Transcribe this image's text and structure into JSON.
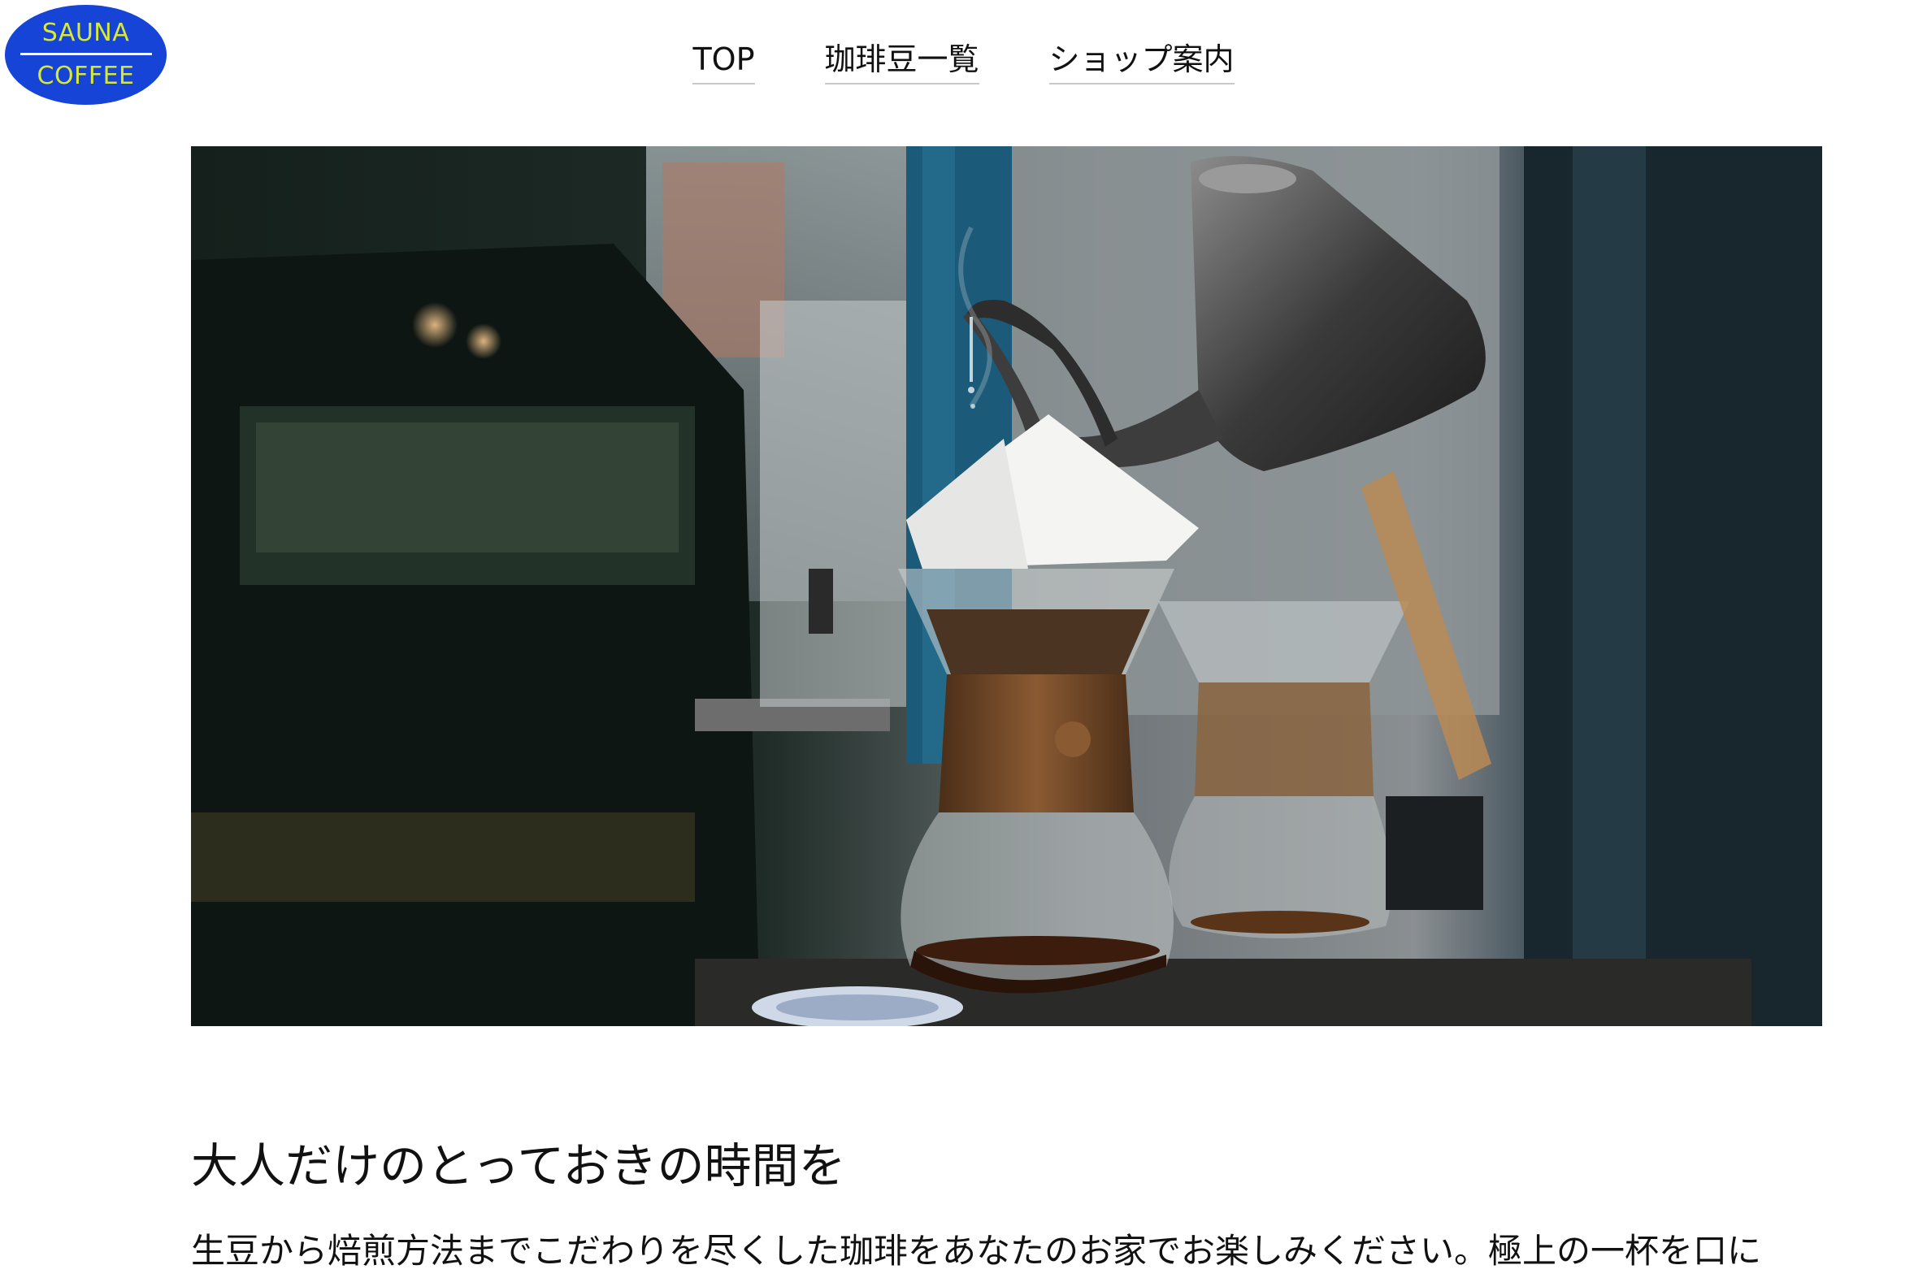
{
  "logo": {
    "line1": "SAUNA",
    "line2": "COFFEE",
    "background_color": "#1544d6",
    "text_color": "#d8e83a"
  },
  "nav": {
    "items": [
      {
        "label": "TOP"
      },
      {
        "label": "珈琲豆一覧"
      },
      {
        "label": "ショップ案内"
      }
    ]
  },
  "hero": {
    "image_subject": "pour-over coffee brewing photo"
  },
  "content": {
    "headline": "大人だけのとっておきの時間を",
    "body": "生豆から焙煎方法までこだわりを尽くした珈琲をあなたのお家でお楽しみください。極上の一杯を口に"
  }
}
